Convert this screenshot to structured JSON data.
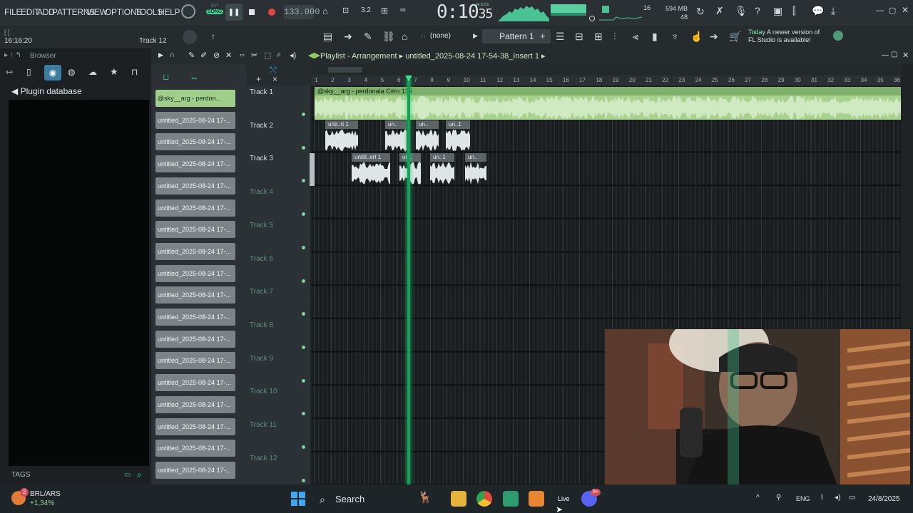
{
  "menu": {
    "items": [
      "FILE",
      "EDIT",
      "ADD",
      "PATTERNS",
      "VIEW",
      "OPTIONS",
      "TOOLS",
      "HELP"
    ]
  },
  "transport": {
    "mode_label": "SONG",
    "mode_label_top": "PAT",
    "tempo": "133.000",
    "time": "0:10",
    "time_small": "35",
    "time_unit_label": "M:S:CS",
    "voices": "16",
    "memory": "594 MB",
    "memory_sub": "48"
  },
  "toolbar2": {
    "clock": "16:16:20",
    "track_label": "Track 12",
    "pattern_select": "(none)",
    "pattern_name": "Pattern 1",
    "notice_title": "Today",
    "notice_text": "A newer version of",
    "notice_text2": "FL Studio is available!"
  },
  "browser": {
    "title": "Browser",
    "plugin_database": "Plugin database",
    "tags_label": "TAGS"
  },
  "playlist": {
    "title": "Playlist - Arrangement",
    "breadcrumb": "untitled_2025-08-24 17-54-38_Insert 1",
    "ruler_numbers": [
      "1",
      "2",
      "3",
      "4",
      "5",
      "6",
      "7",
      "8",
      "9",
      "10",
      "11",
      "12",
      "13",
      "14",
      "15",
      "16",
      "17",
      "18",
      "19",
      "20",
      "21",
      "22",
      "23",
      "24",
      "25",
      "26",
      "27",
      "28",
      "29",
      "30",
      "31",
      "32",
      "33",
      "34",
      "35",
      "36"
    ],
    "tracks": [
      {
        "name": "Track 1",
        "empty": false
      },
      {
        "name": "Track 2",
        "empty": false
      },
      {
        "name": "Track 3",
        "empty": false
      },
      {
        "name": "Track 4",
        "empty": true
      },
      {
        "name": "Track 5",
        "empty": true
      },
      {
        "name": "Track 6",
        "empty": true
      },
      {
        "name": "Track 7",
        "empty": true
      },
      {
        "name": "Track 8",
        "empty": true
      },
      {
        "name": "Track 9",
        "empty": true
      },
      {
        "name": "Track 10",
        "empty": true
      },
      {
        "name": "Track 11",
        "empty": true
      },
      {
        "name": "Track 12",
        "empty": true
      }
    ],
    "main_clip_label": "@sky__arg - perdonala C#m 133",
    "track2_clips": [
      "unti..rt 1",
      "un..",
      "un..",
      "un..1"
    ],
    "track3_clips": [
      "untitl..ert 1",
      "un..",
      "un..1",
      "un.."
    ]
  },
  "clip_list": {
    "items": [
      "@sky__arg - perdon...",
      "untitled_2025-08-24 17-...",
      "untitled_2025-08-24 17-...",
      "untitled_2025-08-24 17-...",
      "untitled_2025-08-24 17-...",
      "untitled_2025-08-24 17-...",
      "untitled_2025-08-24 17-...",
      "untitled_2025-08-24 17-...",
      "untitled_2025-08-24 17-...",
      "untitled_2025-08-24 17-...",
      "untitled_2025-08-24 17-...",
      "untitled_2025-08-24 17-...",
      "untitled_2025-08-24 17-...",
      "untitled_2025-08-24 17-...",
      "untitled_2025-08-24 17-...",
      "untitled_2025-08-24 17-...",
      "untitled_2025-08-24 17-...",
      "untitled_2025-08-24 17-..."
    ]
  },
  "taskbar": {
    "ticker_name": "BRL/ARS",
    "ticker_change": "+1,34%",
    "ticker_badge": "2",
    "search_label": "Search",
    "live_label": "Live",
    "discord_badge": "9+",
    "language": "ENG",
    "date": "24/8/2025"
  },
  "colors": {
    "accent": "#16a057",
    "clip_green": "#a6d28d",
    "clip_gray": "#7d8488"
  }
}
